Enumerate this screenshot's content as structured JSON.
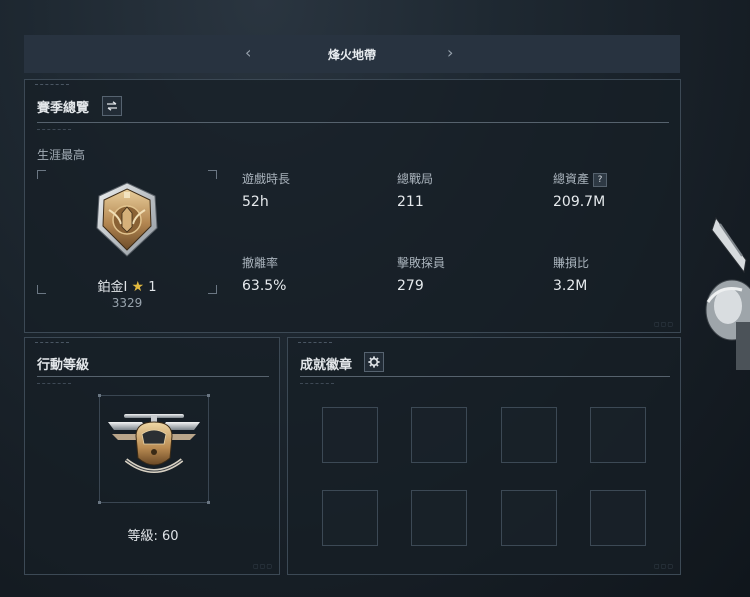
{
  "topbar": {
    "title": "烽火地帶",
    "prev_icon": "chevron-left-icon",
    "next_icon": "chevron-right-icon"
  },
  "season": {
    "title": "賽季總覽",
    "switch_icon": "swap-arrows-icon",
    "career_label": "生涯最高",
    "rank": {
      "tier": "鉑金I",
      "star_icon": "star-icon",
      "stars": "1",
      "points": "3329",
      "emblem_icon": "platinum-rank-emblem-icon"
    },
    "stats": [
      {
        "label": "遊戲時長",
        "value": "52h"
      },
      {
        "label": "總戰局",
        "value": "211"
      },
      {
        "label": "總資產",
        "value": "209.7M",
        "help": "?"
      },
      {
        "label": "撤離率",
        "value": "63.5%"
      },
      {
        "label": "擊敗探員",
        "value": "279"
      },
      {
        "label": "賺損比",
        "value": "3.2M"
      }
    ]
  },
  "action_level": {
    "title": "行動等級",
    "emblem_icon": "helicopter-emblem-icon",
    "level_label": "等級:",
    "level_value": "60"
  },
  "badges": {
    "title": "成就徽章",
    "settings_icon": "gear-icon",
    "slot_count": 8
  },
  "colors": {
    "background": "#1a232c",
    "panel_border": "#3c4955",
    "topbar": "#283340",
    "gold": "#c9a065",
    "star": "#e2b93f"
  }
}
